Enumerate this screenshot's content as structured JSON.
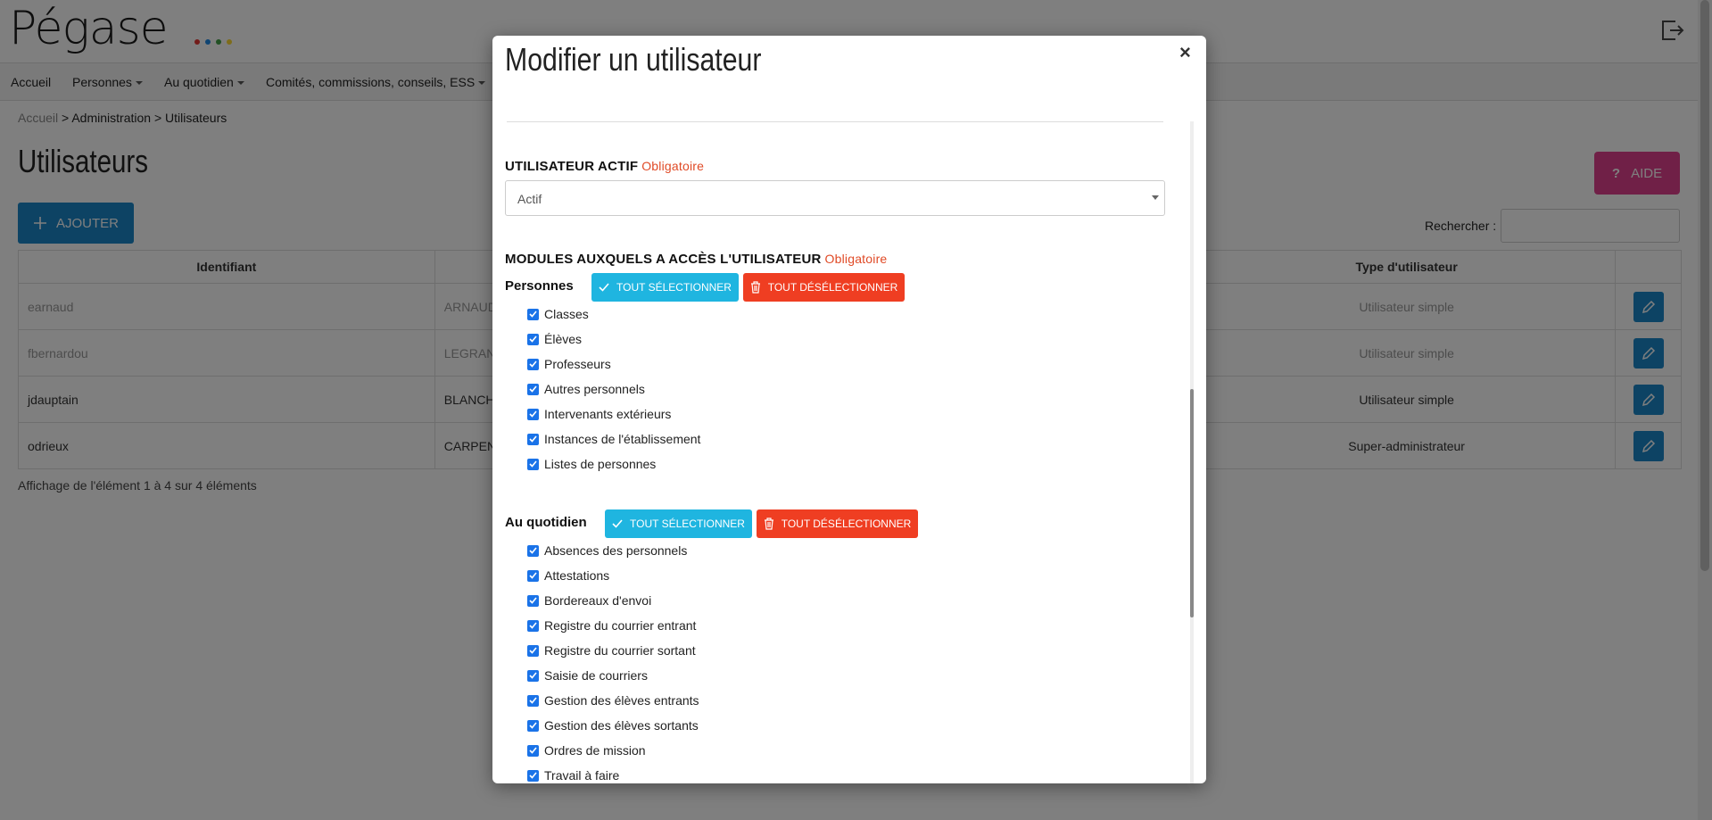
{
  "app": {
    "logo_text": "Pégase",
    "logo_dot_colors": [
      "#e53935",
      "#1e88e5",
      "#43a047",
      "#fdd835"
    ]
  },
  "nav": {
    "items": [
      {
        "label": "Accueil",
        "dropdown": false
      },
      {
        "label": "Personnes",
        "dropdown": true
      },
      {
        "label": "Au quotidien",
        "dropdown": true
      },
      {
        "label": "Comités, commissions, conseils, ESS",
        "dropdown": true
      }
    ]
  },
  "breadcrumb": {
    "home": "Accueil",
    "sep": ">",
    "admin": "Administration",
    "current": "Utilisateurs"
  },
  "page": {
    "title": "Utilisateurs",
    "add_label": "AJOUTER",
    "help_label": "AIDE",
    "search_label": "Rechercher :",
    "search_value": "",
    "info": "Affichage de l'élément 1 à 4 sur 4 éléments"
  },
  "table": {
    "headers": [
      "Identifiant",
      "",
      "Type d'utilisateur",
      ""
    ],
    "rows": [
      {
        "id": "earnaud",
        "name": "ARNAUD",
        "type": "Utilisateur simple",
        "active": false
      },
      {
        "id": "fbernardou",
        "name": "LEGRAN",
        "type": "Utilisateur simple",
        "active": false
      },
      {
        "id": "jdauptain",
        "name": "BLANCH",
        "type": "Utilisateur simple",
        "active": true
      },
      {
        "id": "odrieux",
        "name": "CARPEN",
        "type": "Super-administrateur",
        "active": true
      }
    ]
  },
  "modal": {
    "title": "Modifier un utilisateur",
    "close": "×",
    "active_label": "UTILISATEUR ACTIF",
    "required": "Obligatoire",
    "active_value": "Actif",
    "modules_label": "MODULES AUXQUELS A ACCÈS L'UTILISATEUR",
    "select_all": "TOUT SÉLECTIONNER",
    "deselect_all": "TOUT DÉSÉLECTIONNER",
    "groups": [
      {
        "title": "Personnes",
        "items": [
          "Classes",
          "Élèves",
          "Professeurs",
          "Autres personnels",
          "Intervenants extérieurs",
          "Instances de l'établissement",
          "Listes de personnes"
        ]
      },
      {
        "title": "Au quotidien",
        "items": [
          "Absences des personnels",
          "Attestations",
          "Bordereaux d'envoi",
          "Registre du courrier entrant",
          "Registre du courrier sortant",
          "Saisie de courriers",
          "Gestion des élèves entrants",
          "Gestion des élèves sortants",
          "Ordres de mission",
          "Travail à faire"
        ]
      }
    ]
  },
  "colors": {
    "primary": "#1a86c8",
    "help": "#e0418e",
    "select_all": "#1fb5e0",
    "deselect_all": "#ef3e22",
    "required": "#e04a26"
  }
}
